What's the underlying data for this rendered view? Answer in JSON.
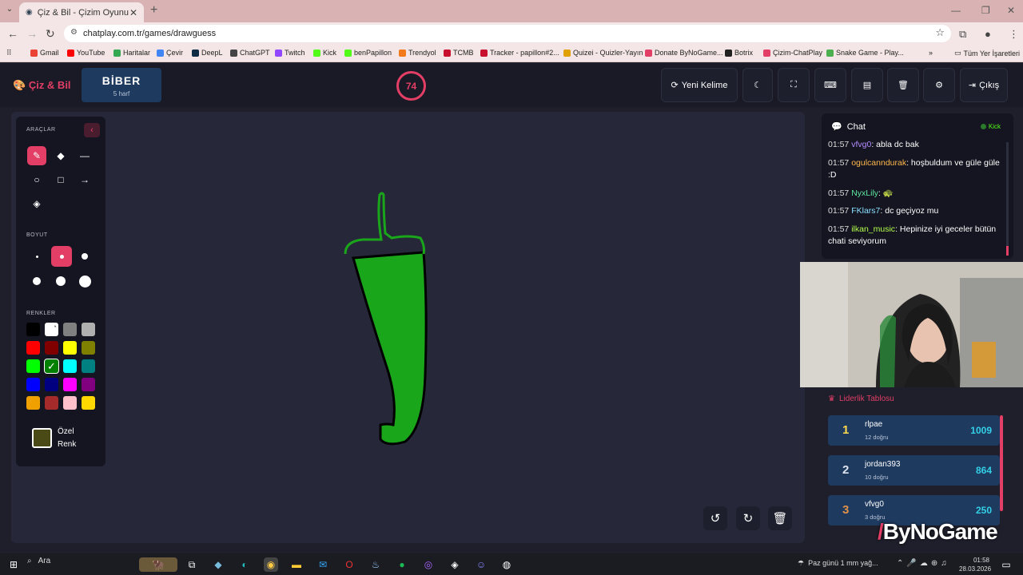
{
  "browser": {
    "tab_title": "Çiz & Bil - Çizim Oyunu",
    "url": "chatplay.com.tr/games/drawguess",
    "bookmarks": [
      {
        "label": "Gmail",
        "color": "#ea4335"
      },
      {
        "label": "YouTube",
        "color": "#ff0000"
      },
      {
        "label": "Haritalar",
        "color": "#34a853"
      },
      {
        "label": "Çevir",
        "color": "#4285f4"
      },
      {
        "label": "DeepL",
        "color": "#0f2b46"
      },
      {
        "label": "ChatGPT",
        "color": "#444444"
      },
      {
        "label": "Twitch",
        "color": "#9146ff"
      },
      {
        "label": "Kick",
        "color": "#53fc18"
      },
      {
        "label": "benPapillon",
        "color": "#53fc18"
      },
      {
        "label": "Trendyol",
        "color": "#f27a1a"
      },
      {
        "label": "TCMB",
        "color": "#c8102e"
      },
      {
        "label": "Tracker - papillon#2...",
        "color": "#c8102e"
      },
      {
        "label": "Quizei - Quizler-Yayın",
        "color": "#e0a000"
      },
      {
        "label": "Donate ByNoGame...",
        "color": "#e23e66"
      },
      {
        "label": "Botrix",
        "color": "#222222"
      },
      {
        "label": "Çizim-ChatPlay",
        "color": "#e23e66"
      },
      {
        "label": "Snake Game - Play...",
        "color": "#4caf50"
      }
    ],
    "all_bookmarks": "Tüm Yer İşaretleri"
  },
  "header": {
    "logo": "Çiz & Bil",
    "word": "BİBER",
    "word_hint": "5 harf",
    "timer": "74",
    "new_word_label": "Yeni Kelime",
    "exit_label": "Çıkış"
  },
  "toolbar": {
    "tools_label": "ARAÇLAR",
    "size_label": "BOYUT",
    "colors_label": "RENKLER",
    "custom_color_label": "Özel Renk",
    "colors": [
      "#000000",
      "#ffffff",
      "#808080",
      "#b0b0b0",
      "#ff0000",
      "#800000",
      "#ffff00",
      "#808000",
      "#00ff00",
      "#008000",
      "#00ffff",
      "#008080",
      "#0000ff",
      "#000080",
      "#ff00ff",
      "#800080",
      "#f0a000",
      "#a52a2a",
      "#ffc0cb",
      "#ffd700"
    ],
    "selected_color": "#008000",
    "custom_color": "#4a4a16"
  },
  "chat": {
    "title": "Chat",
    "platform": "Kick",
    "messages": [
      {
        "time": "01:57",
        "user": "vfvg0",
        "user_color": "#b48cff",
        "text": ": abla dc bak"
      },
      {
        "time": "01:57",
        "user": "ogulcanndurak",
        "user_color": "#ffb84d",
        "text": ": hoşbuldum ve güle güle :D"
      },
      {
        "time": "01:57",
        "user": "NyxLily",
        "user_color": "#5ee6a0",
        "text": ": 🐢"
      },
      {
        "time": "01:57",
        "user": "FKlars7",
        "user_color": "#8ce0ff",
        "text": ": dc geçiyoz mu"
      },
      {
        "time": "01:57",
        "user": "ilkan_music",
        "user_color": "#b4ff4d",
        "text": ": Hepinize iyi geceler bütün chati seviyorum"
      }
    ]
  },
  "leaderboard": {
    "title": "Liderlik Tablosu",
    "rows": [
      {
        "rank": "1",
        "name": "rlpae",
        "sub": "12 doğru",
        "score": "1009",
        "rank_color": "#ffd84d"
      },
      {
        "rank": "2",
        "name": "jordan393",
        "sub": "10 doğru",
        "score": "864",
        "rank_color": "#dde3ee"
      },
      {
        "rank": "3",
        "name": "vfvg0",
        "sub": "3 doğru",
        "score": "250",
        "rank_color": "#e0924a"
      }
    ]
  },
  "overlay": {
    "brand": "ByNoGame"
  },
  "taskbar": {
    "search": "Ara",
    "weather": "Paz günü 1 mm yağ...",
    "time": "01:58",
    "date": "28.03.2026"
  }
}
